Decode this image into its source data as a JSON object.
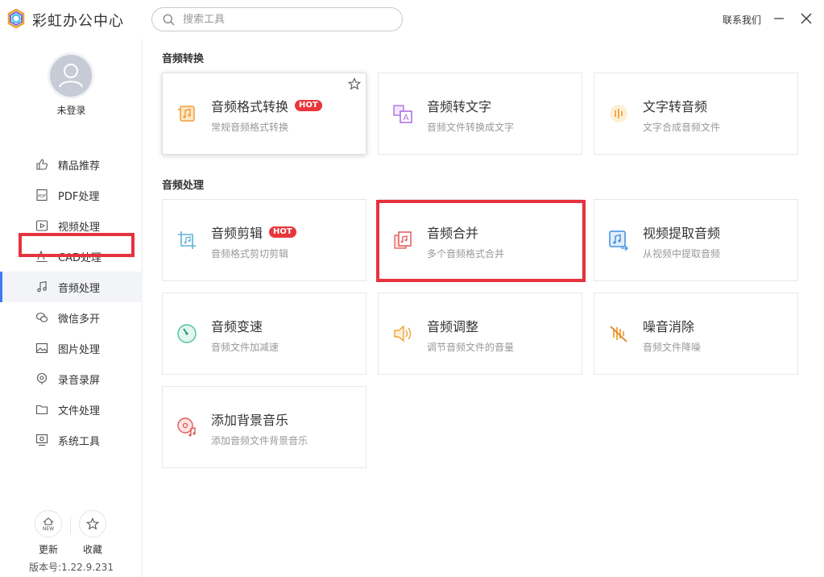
{
  "app": {
    "title": "彩虹办公中心"
  },
  "search": {
    "placeholder": "搜索工具"
  },
  "header": {
    "contact": "联系我们"
  },
  "user": {
    "label": "未登录"
  },
  "sidebar": {
    "items": [
      {
        "label": "精品推荐",
        "icon": "thumb-up-icon"
      },
      {
        "label": "PDF处理",
        "icon": "pdf-icon"
      },
      {
        "label": "视频处理",
        "icon": "video-play-icon"
      },
      {
        "label": "CAD处理",
        "icon": "cad-icon"
      },
      {
        "label": "音频处理",
        "icon": "music-note-icon",
        "active": true
      },
      {
        "label": "微信多开",
        "icon": "wechat-icon"
      },
      {
        "label": "图片处理",
        "icon": "image-icon"
      },
      {
        "label": "录音录屏",
        "icon": "record-icon"
      },
      {
        "label": "文件处理",
        "icon": "folder-icon"
      },
      {
        "label": "系统工具",
        "icon": "monitor-icon"
      }
    ],
    "update_label": "更新",
    "update_badge": "NEW",
    "fav_label": "收藏",
    "version": "版本号:1.22.9.231"
  },
  "sections": [
    {
      "title": "音频转换",
      "cards": [
        {
          "title": "音频格式转换",
          "desc": "常规音频格式转换",
          "hot": "HOT",
          "icon": "audio-convert-icon"
        },
        {
          "title": "音频转文字",
          "desc": "音频文件转换成文字",
          "icon": "audio-to-text-icon"
        },
        {
          "title": "文字转音频",
          "desc": "文字合成音频文件",
          "icon": "text-to-audio-icon"
        }
      ]
    },
    {
      "title": "音频处理",
      "cards": [
        {
          "title": "音频剪辑",
          "desc": "音频格式剪切剪辑",
          "hot": "HOT",
          "icon": "audio-crop-icon"
        },
        {
          "title": "音频合并",
          "desc": "多个音频格式合并",
          "icon": "audio-merge-icon"
        },
        {
          "title": "视频提取音频",
          "desc": "从视频中提取音频",
          "icon": "extract-audio-icon"
        },
        {
          "title": "音频变速",
          "desc": "音频文件加减速",
          "icon": "speed-icon"
        },
        {
          "title": "音频调整",
          "desc": "调节音频文件的音量",
          "icon": "volume-icon"
        },
        {
          "title": "噪音消除",
          "desc": "音频文件降噪",
          "icon": "noise-reduce-icon"
        },
        {
          "title": "添加背景音乐",
          "desc": "添加音频文件背景音乐",
          "icon": "bg-music-icon"
        }
      ]
    }
  ],
  "colors": {
    "highlight": "#e7323f",
    "hot_badge": "#e8363b",
    "accent": "#3b7cf6"
  }
}
